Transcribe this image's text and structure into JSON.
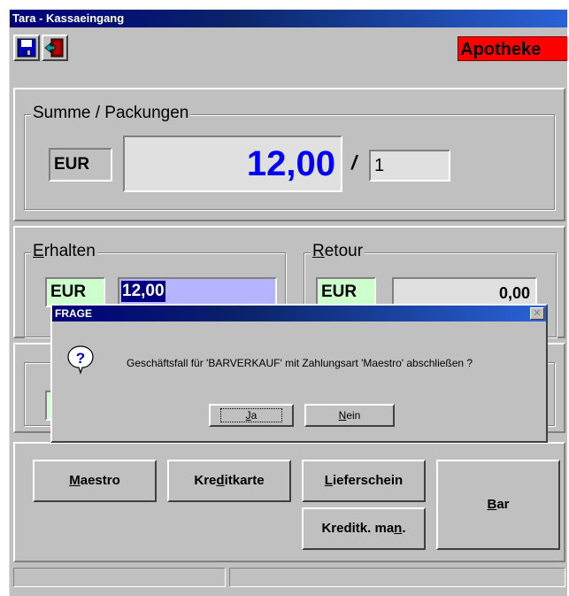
{
  "window": {
    "title": "Tara - Kassaeingang"
  },
  "toolbar": {
    "save_icon": "floppy-disk-icon",
    "exit_icon": "exit-door-icon",
    "tag": "Apotheke"
  },
  "summe": {
    "legend": "Summe / Packungen",
    "currency": "EUR",
    "amount": "12,00",
    "separator": "/",
    "packungen": "1"
  },
  "erhalten": {
    "legend_u": "E",
    "legend_rest": "rhalten",
    "currency": "EUR",
    "value": "12,00"
  },
  "retour": {
    "legend_u": "R",
    "legend_rest": "etour",
    "currency": "EUR",
    "value": "0,00"
  },
  "buttons": {
    "maestro": {
      "u": "M",
      "rest": "aestro"
    },
    "kreditkarte": {
      "pre": "Kre",
      "u": "d",
      "rest": "itkarte"
    },
    "lieferschein": {
      "u": "L",
      "rest": "ieferschein"
    },
    "kreditk_man": {
      "pre": "Kreditk. ma",
      "u": "n",
      "rest": "."
    },
    "bar": {
      "u": "B",
      "rest": "ar"
    }
  },
  "dialog": {
    "title": "FRAGE",
    "icon": "question-icon",
    "message": "Geschäftsfall für 'BARVERKAUF' mit Zahlungsart 'Maestro' abschließen ?",
    "ja": {
      "u": "J",
      "rest": "a"
    },
    "nein": {
      "u": "N",
      "rest": "ein"
    }
  },
  "colors": {
    "amount_blue": "#0000ff",
    "eur_green": "#ccffcc",
    "apotheke_red": "#ff0000",
    "selection_blue": "#b4b4ff"
  }
}
